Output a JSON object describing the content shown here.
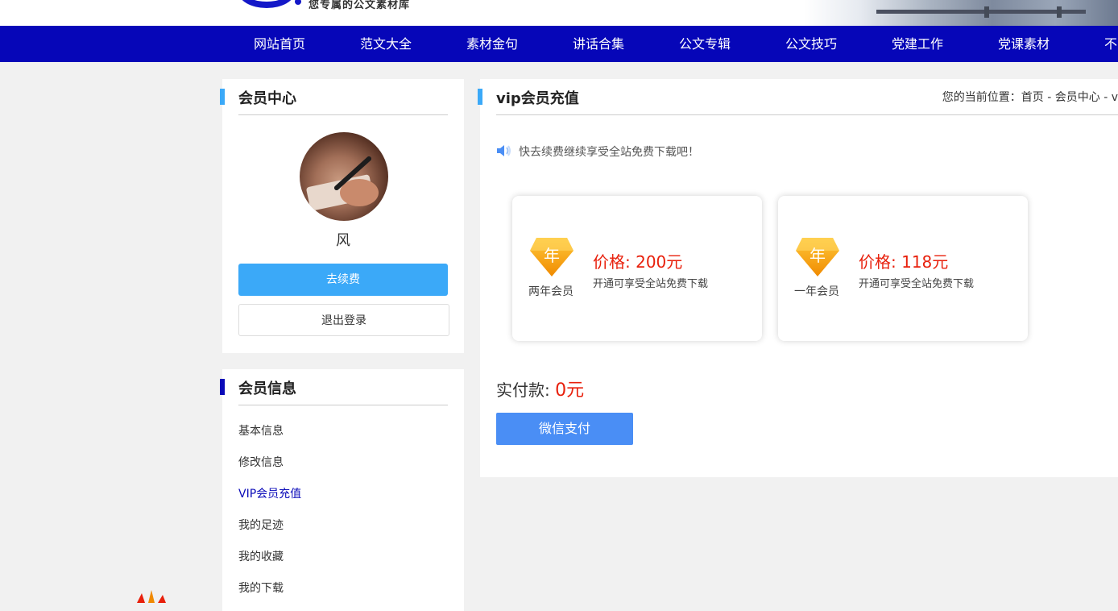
{
  "header": {
    "slogan": "您专属的公文素材库",
    "nav": [
      "网站首页",
      "范文大全",
      "素材金句",
      "讲话合集",
      "公文专辑",
      "公文技巧",
      "党建工作",
      "党课素材",
      "不"
    ]
  },
  "sidebar": {
    "member_center_title": "会员中心",
    "username": "风",
    "renew_label": "去续费",
    "logout_label": "退出登录",
    "member_info_title": "会员信息",
    "menu": [
      {
        "label": "基本信息",
        "active": false
      },
      {
        "label": "修改信息",
        "active": false
      },
      {
        "label": "VIP会员充值",
        "active": true
      },
      {
        "label": "我的足迹",
        "active": false
      },
      {
        "label": "我的收藏",
        "active": false
      },
      {
        "label": "我的下载",
        "active": false
      }
    ]
  },
  "main": {
    "title": "vip会员充值",
    "breadcrumb": "您的当前位置：首页 - 会员中心 - v",
    "notice": "快去续费继续享受全站免费下载吧！",
    "plans": [
      {
        "badge": "年",
        "name": "两年会员",
        "price": "价格: 200元",
        "desc": "开通可享受全站免费下载"
      },
      {
        "badge": "年",
        "name": "一年会员",
        "price": "价格: 118元",
        "desc": "开通可享受全站免费下载"
      }
    ],
    "pay_label": "实付款:",
    "pay_amount": "0元",
    "wechat_pay_label": "微信支付"
  },
  "colors": {
    "nav_bg": "#0606b8",
    "accent_blue": "#3ba9f8",
    "price_red": "#e8200c",
    "wechat_button": "#4a8ef5"
  }
}
